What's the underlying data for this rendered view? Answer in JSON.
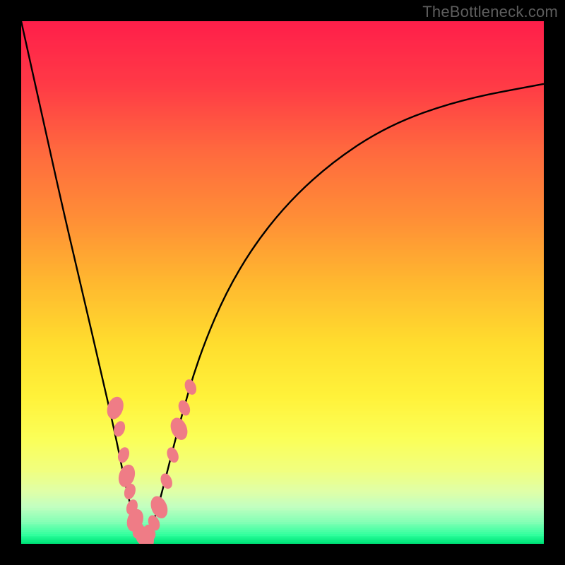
{
  "watermark": "TheBottleneck.com",
  "colors": {
    "frame": "#000000",
    "curve": "#000000",
    "bead": "#ef7c86"
  },
  "gradient_stops": [
    {
      "pos": 0.0,
      "color": "#ff1f4a"
    },
    {
      "pos": 0.12,
      "color": "#ff3a46"
    },
    {
      "pos": 0.25,
      "color": "#ff6a3e"
    },
    {
      "pos": 0.38,
      "color": "#ff8f36"
    },
    {
      "pos": 0.5,
      "color": "#ffb82f"
    },
    {
      "pos": 0.62,
      "color": "#ffde2e"
    },
    {
      "pos": 0.72,
      "color": "#fff23a"
    },
    {
      "pos": 0.8,
      "color": "#fbff58"
    },
    {
      "pos": 0.86,
      "color": "#f1ff7e"
    },
    {
      "pos": 0.9,
      "color": "#e0ffa6"
    },
    {
      "pos": 0.93,
      "color": "#c3ffc0"
    },
    {
      "pos": 0.96,
      "color": "#84ffb5"
    },
    {
      "pos": 0.985,
      "color": "#2fff9d"
    },
    {
      "pos": 1.0,
      "color": "#00e67a"
    }
  ],
  "chart_data": {
    "type": "line",
    "title": "",
    "xlabel": "",
    "ylabel": "",
    "x_range": [
      0,
      100
    ],
    "y_range": [
      0,
      100
    ],
    "note": "V-shaped bottleneck curve. y represents mismatch (0 = ideal, 100 = worst). Minimum near x ≈ 23 where y ≈ 0. Background gradient maps y-value to severity color (green at bottom, red at top).",
    "series": [
      {
        "name": "bottleneck-curve",
        "x": [
          0,
          4,
          8,
          12,
          15,
          18,
          20,
          22,
          23,
          25,
          27,
          30,
          34,
          40,
          48,
          58,
          70,
          84,
          100
        ],
        "y": [
          100,
          82,
          64,
          47,
          34,
          21,
          11,
          3,
          0,
          3,
          10,
          22,
          36,
          50,
          62,
          72,
          80,
          85,
          88
        ]
      }
    ],
    "markers": {
      "name": "highlight-beads",
      "note": "Pink rounded markers clustered near the valley of the curve, on both arms.",
      "points": [
        {
          "x": 18.0,
          "y": 26
        },
        {
          "x": 18.8,
          "y": 22
        },
        {
          "x": 19.6,
          "y": 17
        },
        {
          "x": 20.2,
          "y": 13
        },
        {
          "x": 20.8,
          "y": 10
        },
        {
          "x": 21.2,
          "y": 7
        },
        {
          "x": 21.8,
          "y": 4.5
        },
        {
          "x": 22.4,
          "y": 2.5
        },
        {
          "x": 23.0,
          "y": 1.2
        },
        {
          "x": 23.8,
          "y": 1.2
        },
        {
          "x": 24.6,
          "y": 2.2
        },
        {
          "x": 25.4,
          "y": 4.0
        },
        {
          "x": 26.4,
          "y": 7.0
        },
        {
          "x": 27.8,
          "y": 12
        },
        {
          "x": 29.0,
          "y": 17
        },
        {
          "x": 30.2,
          "y": 22
        },
        {
          "x": 31.2,
          "y": 26
        },
        {
          "x": 32.4,
          "y": 30
        }
      ]
    }
  }
}
